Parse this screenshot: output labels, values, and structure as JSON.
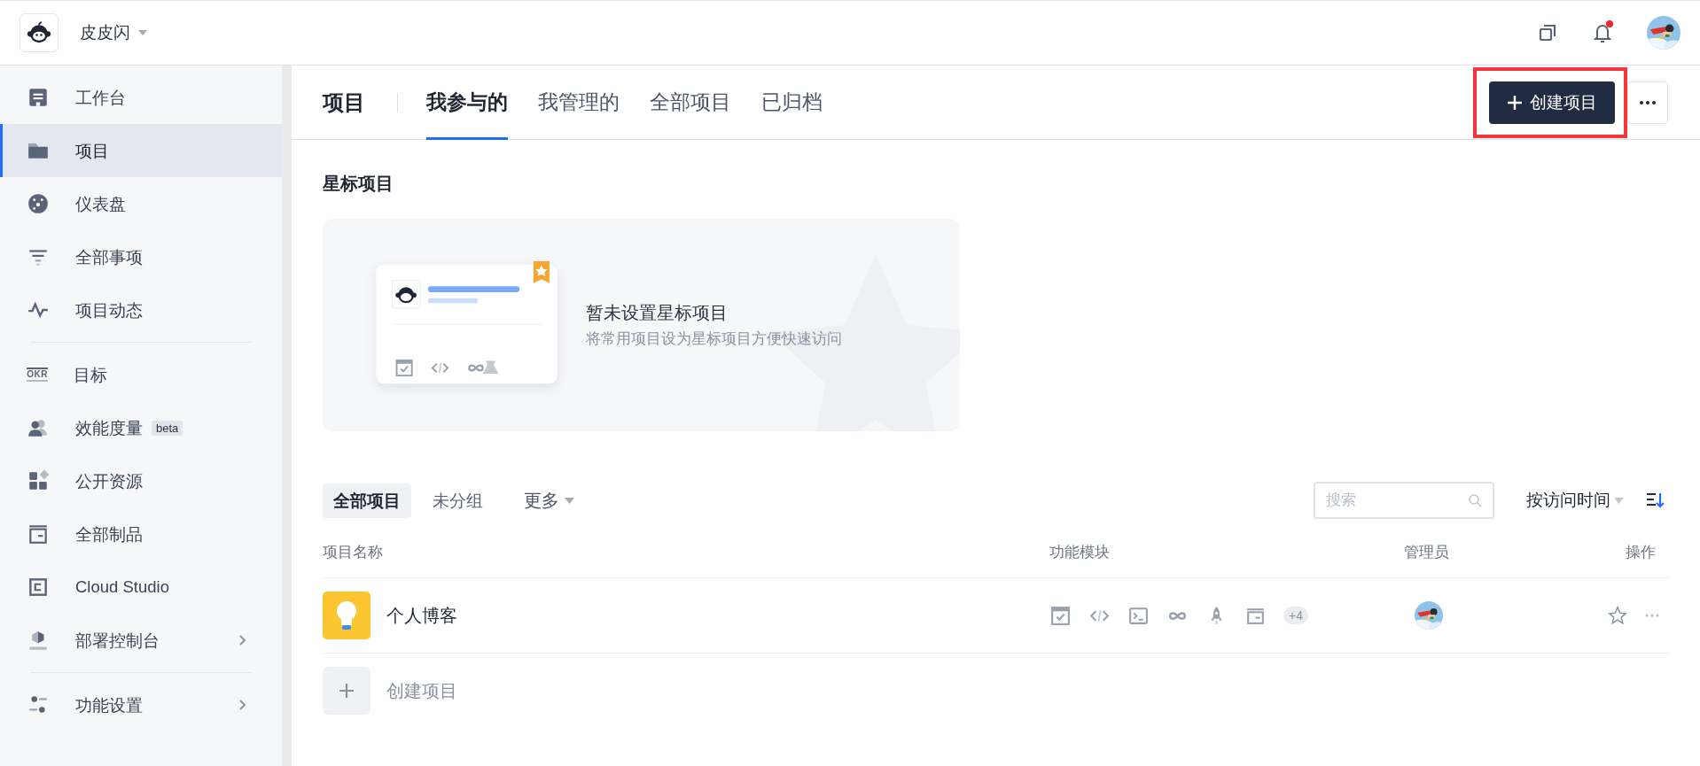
{
  "topbar": {
    "team": "皮皮闪",
    "notification_dot": true
  },
  "sidebar": {
    "groups": [
      [
        {
          "label": "工作台",
          "kind": "desk",
          "selected": false
        },
        {
          "label": "项目",
          "kind": "folder",
          "selected": true
        },
        {
          "label": "仪表盘",
          "kind": "dashboard",
          "selected": false
        },
        {
          "label": "全部事项",
          "kind": "filter",
          "selected": false
        },
        {
          "label": "项目动态",
          "kind": "pulse",
          "selected": false
        }
      ],
      [
        {
          "label": "目标",
          "kind": "okr",
          "icon_text": "OKR",
          "selected": false
        },
        {
          "label": "效能度量",
          "kind": "people",
          "badge": "beta",
          "selected": false
        },
        {
          "label": "公开资源",
          "kind": "apps",
          "selected": false
        },
        {
          "label": "全部制品",
          "kind": "box",
          "selected": false
        },
        {
          "label": "Cloud Studio",
          "kind": "square",
          "selected": false
        },
        {
          "label": "部署控制台",
          "kind": "deploy",
          "submenu": true,
          "selected": false
        }
      ],
      [
        {
          "label": "功能设置",
          "kind": "sliders",
          "submenu": true,
          "selected": false
        }
      ]
    ]
  },
  "header": {
    "title": "项目",
    "tabs": [
      {
        "label": "我参与的",
        "selected": true
      },
      {
        "label": "我管理的",
        "selected": false
      },
      {
        "label": "全部项目",
        "selected": false
      },
      {
        "label": "已归档",
        "selected": false
      }
    ],
    "create_button": {
      "label": "创建项目",
      "highlighted": true
    }
  },
  "starred": {
    "title": "星标项目",
    "empty_title": "暂未设置星标项目",
    "empty_hint": "将常用项目设为星标项目方便快速访问"
  },
  "list": {
    "filters": [
      {
        "label": "全部项目",
        "selected": true
      },
      {
        "label": "未分组",
        "selected": false
      }
    ],
    "more": "更多",
    "search": {
      "placeholder": "搜索"
    },
    "sort": "按访问时间",
    "columns": [
      "项目名称",
      "功能模块",
      "管理员",
      "操作"
    ],
    "rows": [
      {
        "name": "个人博客",
        "modules": [
          {
            "kind": "check"
          },
          {
            "kind": "code"
          },
          {
            "kind": "terminal"
          },
          {
            "kind": "infinity"
          },
          {
            "kind": "rocket"
          },
          {
            "kind": "box"
          }
        ],
        "extra": "+4",
        "starred": false
      }
    ],
    "create_row": "创建项目"
  }
}
